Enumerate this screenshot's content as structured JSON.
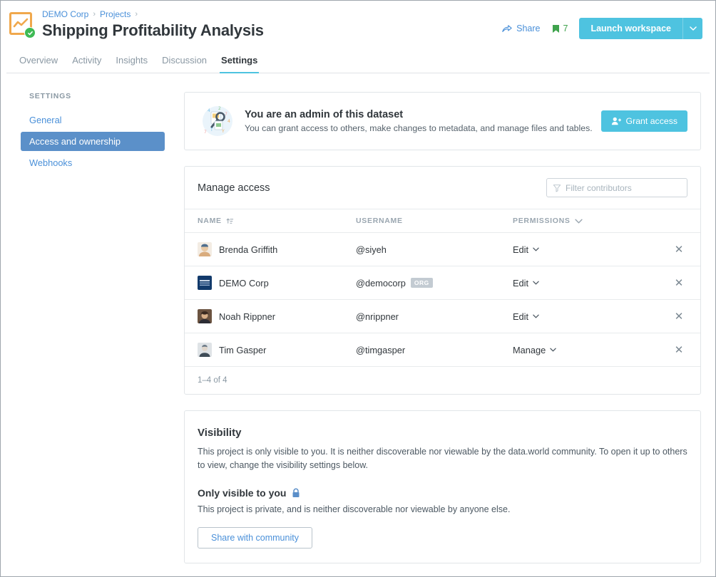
{
  "header": {
    "breadcrumb": [
      {
        "label": "DEMO Corp"
      },
      {
        "label": "Projects"
      }
    ],
    "breadcrumb_separator": "›",
    "title": "Shipping Profitability Analysis",
    "avatar_icon": "project-chart-icon",
    "verified_icon": "verified-check-icon",
    "share_label": "Share",
    "share_icon": "share-arrow-icon",
    "bookmark_icon": "bookmark-icon",
    "bookmark_count": "7",
    "launch_label": "Launch workspace",
    "launch_caret_icon": "chevron-down-icon"
  },
  "tabs": [
    {
      "label": "Overview",
      "active": false
    },
    {
      "label": "Activity",
      "active": false
    },
    {
      "label": "Insights",
      "active": false
    },
    {
      "label": "Discussion",
      "active": false
    },
    {
      "label": "Settings",
      "active": true
    }
  ],
  "sidebar": {
    "heading": "SETTINGS",
    "items": [
      {
        "label": "General",
        "active": false
      },
      {
        "label": "Access and ownership",
        "active": true
      },
      {
        "label": "Webhooks",
        "active": false
      }
    ]
  },
  "admin_banner": {
    "illustration_icon": "admin-dataset-illustration",
    "title": "You are an admin of this dataset",
    "subtitle": "You can grant access to others, make changes to metadata, and manage files and tables.",
    "grant_button_label": "Grant access",
    "grant_button_icon": "person-add-icon"
  },
  "manage_access": {
    "title": "Manage access",
    "filter_icon": "filter-funnel-icon",
    "filter_placeholder": "Filter contributors",
    "filter_value": "",
    "columns": [
      {
        "label": "NAME",
        "icon": "sort-ascending-icon"
      },
      {
        "label": "USERNAME",
        "icon": ""
      },
      {
        "label": "PERMISSIONS",
        "icon": "chevron-down-icon"
      },
      {
        "label": "",
        "icon": ""
      }
    ],
    "rows": [
      {
        "name": "Brenda Griffith",
        "username": "@siyeh",
        "is_org": false,
        "org_badge": "",
        "permission": "Edit",
        "avatar_colors": [
          "#f2d9c0",
          "#d9ac7e",
          "#4e6e8e"
        ],
        "remove_icon": "close-icon"
      },
      {
        "name": "DEMO Corp",
        "username": "@democorp",
        "is_org": true,
        "org_badge": "ORG",
        "permission": "Edit",
        "avatar_colors": [
          "#123a6b",
          "#1d4f8f",
          "#c8d4e4"
        ],
        "remove_icon": "close-icon"
      },
      {
        "name": "Noah Rippner",
        "username": "@nrippner",
        "is_org": false,
        "org_badge": "",
        "permission": "Edit",
        "avatar_colors": [
          "#3a2a20",
          "#6b5340",
          "#a98b6c"
        ],
        "remove_icon": "close-icon"
      },
      {
        "name": "Tim Gasper",
        "username": "@timgasper",
        "is_org": false,
        "org_badge": "",
        "permission": "Manage",
        "avatar_colors": [
          "#b9c4cf",
          "#6d7b88",
          "#e0d6cb"
        ],
        "remove_icon": "close-icon"
      }
    ],
    "pagination": "1–4 of 4"
  },
  "visibility": {
    "title": "Visibility",
    "description": "This project is only visible to you. It is neither discoverable nor viewable by the data.world community. To open it up to others to view, change the visibility settings below.",
    "status_label": "Only visible to you",
    "status_icon": "lock-icon",
    "status_description": "This project is private, and is neither discoverable nor viewable by anyone else.",
    "share_button_label": "Share with community"
  },
  "colors": {
    "accent": "#4ec3e0",
    "link": "#4a90d9",
    "sidebar_active": "#5b90c9",
    "verified_green": "#3fba55",
    "avatar_frame": "#f0a84c",
    "lock_blue": "#5b8fc9",
    "org_badge": "#c3cbd2"
  }
}
